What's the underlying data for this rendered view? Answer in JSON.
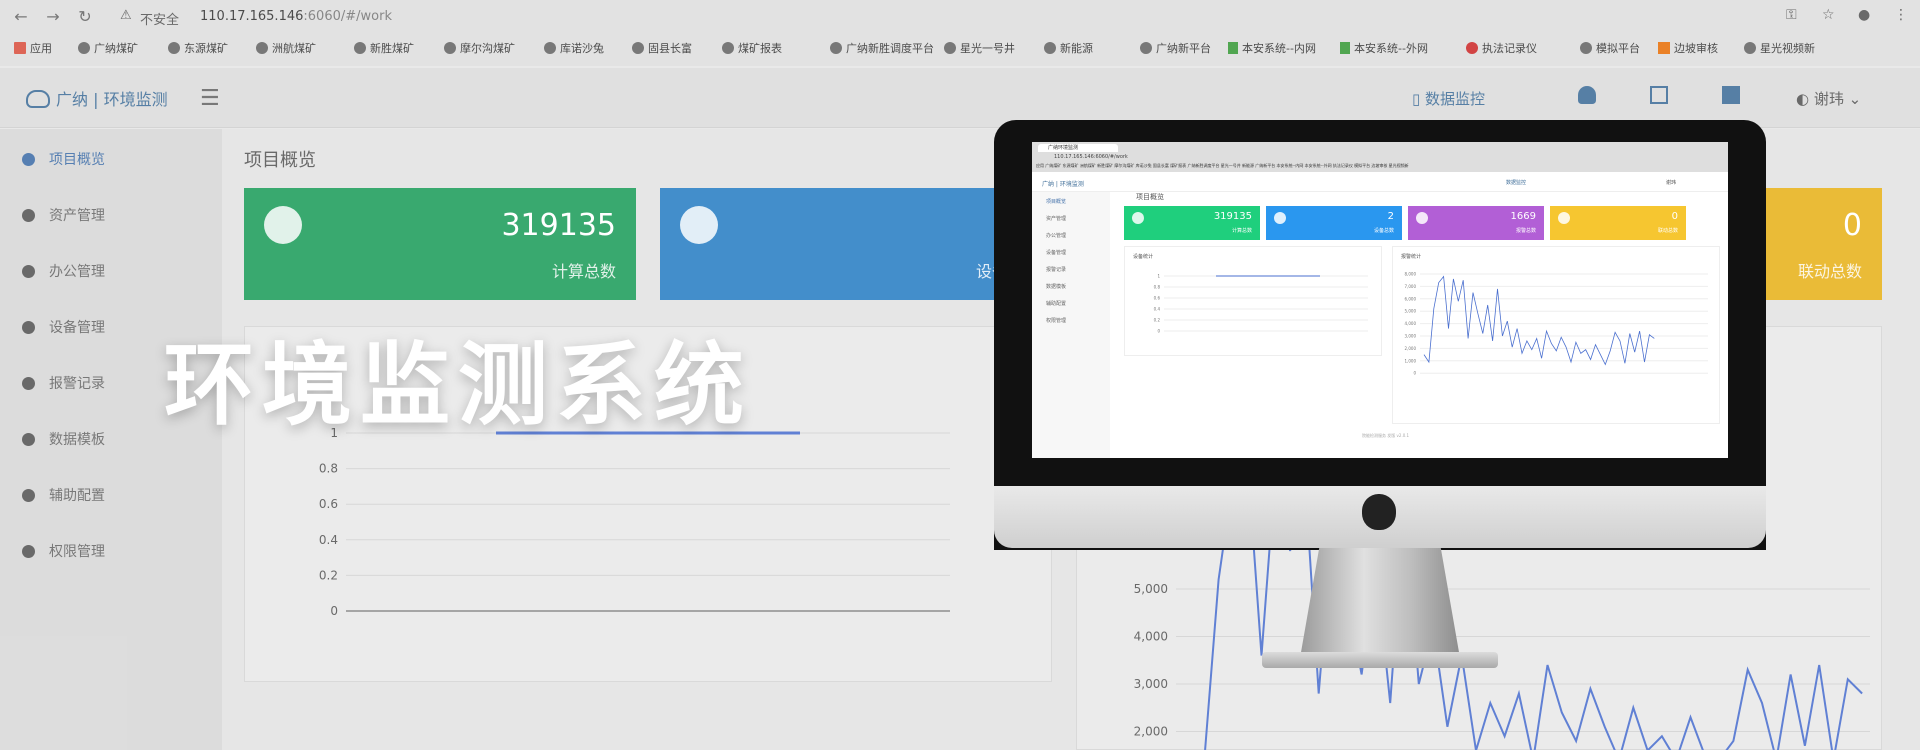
{
  "browser": {
    "security_label": "不安全",
    "url_host": "110.17.165.146",
    "url_rest": ":6060/#/work",
    "bookmarks": [
      "应用",
      "广纳煤矿",
      "东源煤矿",
      "洲航煤矿",
      "新胜煤矿",
      "摩尔沟煤矿",
      "库诺沙兔",
      "固县长富",
      "煤矿报表",
      "广纳新胜调度平台",
      "星光一号井",
      "新能源",
      "广纳新平台",
      "本安系统--内网",
      "本安系统--外网",
      "执法记录仪",
      "模拟平台",
      "边坡审核",
      "星光视频新"
    ]
  },
  "app": {
    "logo_text": "广纳 | 环境监测",
    "topnav_item": "数据监控",
    "user_name": "谢玮",
    "page_title": "项目概览",
    "sidebar": [
      "项目概览",
      "资产管理",
      "办公管理",
      "设备管理",
      "报警记录",
      "数据模板",
      "辅助配置",
      "权限管理"
    ],
    "cards": [
      {
        "value": "319135",
        "label": "计算总数",
        "color": "#1e9e5c"
      },
      {
        "value": "2",
        "label": "设备总数",
        "color": "#2a7fc4"
      },
      {
        "value": "0",
        "label": "联动总数",
        "color": "#e8b21c"
      }
    ],
    "left_chart_ticks": [
      "1",
      "0.8",
      "0.6",
      "0.4",
      "0.2",
      "0"
    ],
    "right_chart_ticks": [
      "5,000",
      "4,000",
      "3,000",
      "2,000"
    ]
  },
  "hero_title": "环境监测系统",
  "screen": {
    "tab_title": "广纳环境监测",
    "url": "110.17.165.146:6060/#/work",
    "logo_text": "广纳 | 环境监测",
    "topnav_item": "数据监控",
    "user_name": "谢玮",
    "page_title": "项目概览",
    "sidebar": [
      "项目概览",
      "资产管理",
      "办公管理",
      "设备管理",
      "报警记录",
      "数据模板",
      "辅助配置",
      "权限管理"
    ],
    "cards": [
      {
        "value": "319135",
        "label": "计算总数",
        "color": "#1fcf7d"
      },
      {
        "value": "2",
        "label": "设备总数",
        "color": "#2a97ef"
      },
      {
        "value": "1669",
        "label": "报警总数",
        "color": "#b25fd6"
      },
      {
        "value": "0",
        "label": "联动总数",
        "color": "#f6c630"
      }
    ],
    "panel_left_title": "设备统计",
    "panel_right_title": "报警统计",
    "left_ticks": [
      "1",
      "0.8",
      "0.6",
      "0.4",
      "0.2",
      "0"
    ],
    "right_ticks": [
      "8,000",
      "7,000",
      "6,000",
      "5,000",
      "4,000",
      "3,000",
      "2,000",
      "1,000",
      "0"
    ],
    "right_series": [
      1500,
      900,
      5200,
      7300,
      7800,
      3600,
      7600,
      5800,
      7500,
      2800,
      6500,
      4800,
      3200,
      5500,
      2600,
      6800,
      3000,
      4200,
      2100,
      3600,
      1600,
      2600,
      1900,
      2800,
      1200,
      3400,
      2400,
      1800,
      2900,
      2100,
      900,
      2500,
      1600,
      1900,
      1100,
      2300,
      1500,
      700,
      1800,
      3300,
      2600,
      800,
      3200,
      1700,
      3400,
      900,
      3100,
      2800
    ],
    "left_line": [
      1,
      1,
      1,
      1,
      1
    ],
    "footer": "院能检测服务 发版 v2.0.1"
  },
  "colors": {
    "accent": "#3f6ea8",
    "chart_line": "#4a6fcf"
  }
}
